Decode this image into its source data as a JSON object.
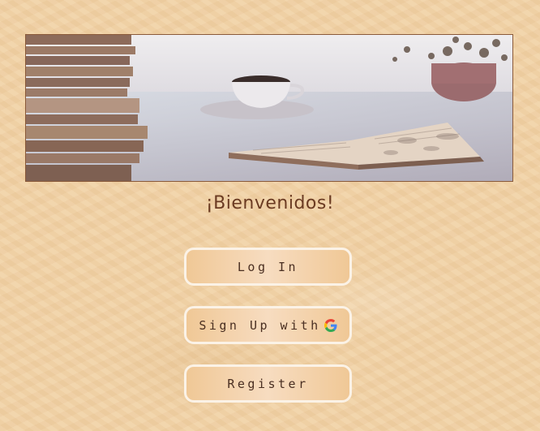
{
  "welcome": {
    "title": "¡Bienvenidos!"
  },
  "banner": {
    "image": "books-and-coffee-photo"
  },
  "buttons": {
    "login": "Log In",
    "google_signup": "Sign Up with",
    "register": "Register"
  },
  "icons": {
    "google": "google-icon"
  },
  "colors": {
    "background": "#f1d2a6",
    "title_text": "#6b3b22",
    "button_border": "#fbf2e6",
    "button_text": "#4a2f22"
  }
}
